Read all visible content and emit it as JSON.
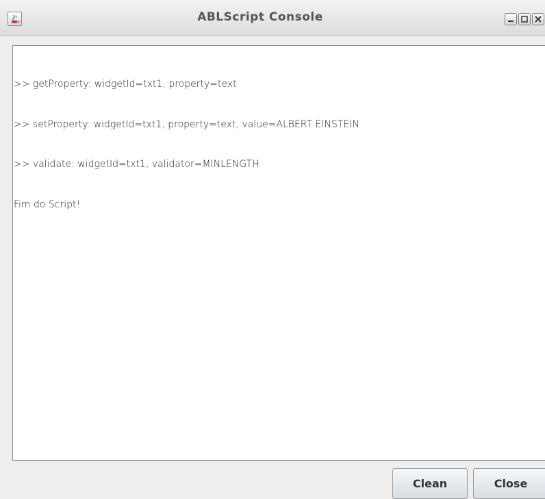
{
  "window": {
    "title": "ABLScript Console",
    "icon": "java-cup-icon",
    "controls": [
      "minimize-icon",
      "maximize-icon",
      "close-icon"
    ]
  },
  "console": {
    "lines": [
      ">> getProperty: widgetId=txt1, property=text",
      ">> setProperty: widgetId=txt1, property=text, value=ALBERT EINSTEIN",
      ">> validate: widgetId=txt1, validator=MINLENGTH",
      "Fim do Script!"
    ]
  },
  "buttons": {
    "clean_label": "Clean",
    "close_label": "Close"
  },
  "colors": {
    "titlebar_bg": "#e4e4e4",
    "title_text": "#555555",
    "console_bg": "#ffffff",
    "window_bg": "#eeeeee"
  }
}
